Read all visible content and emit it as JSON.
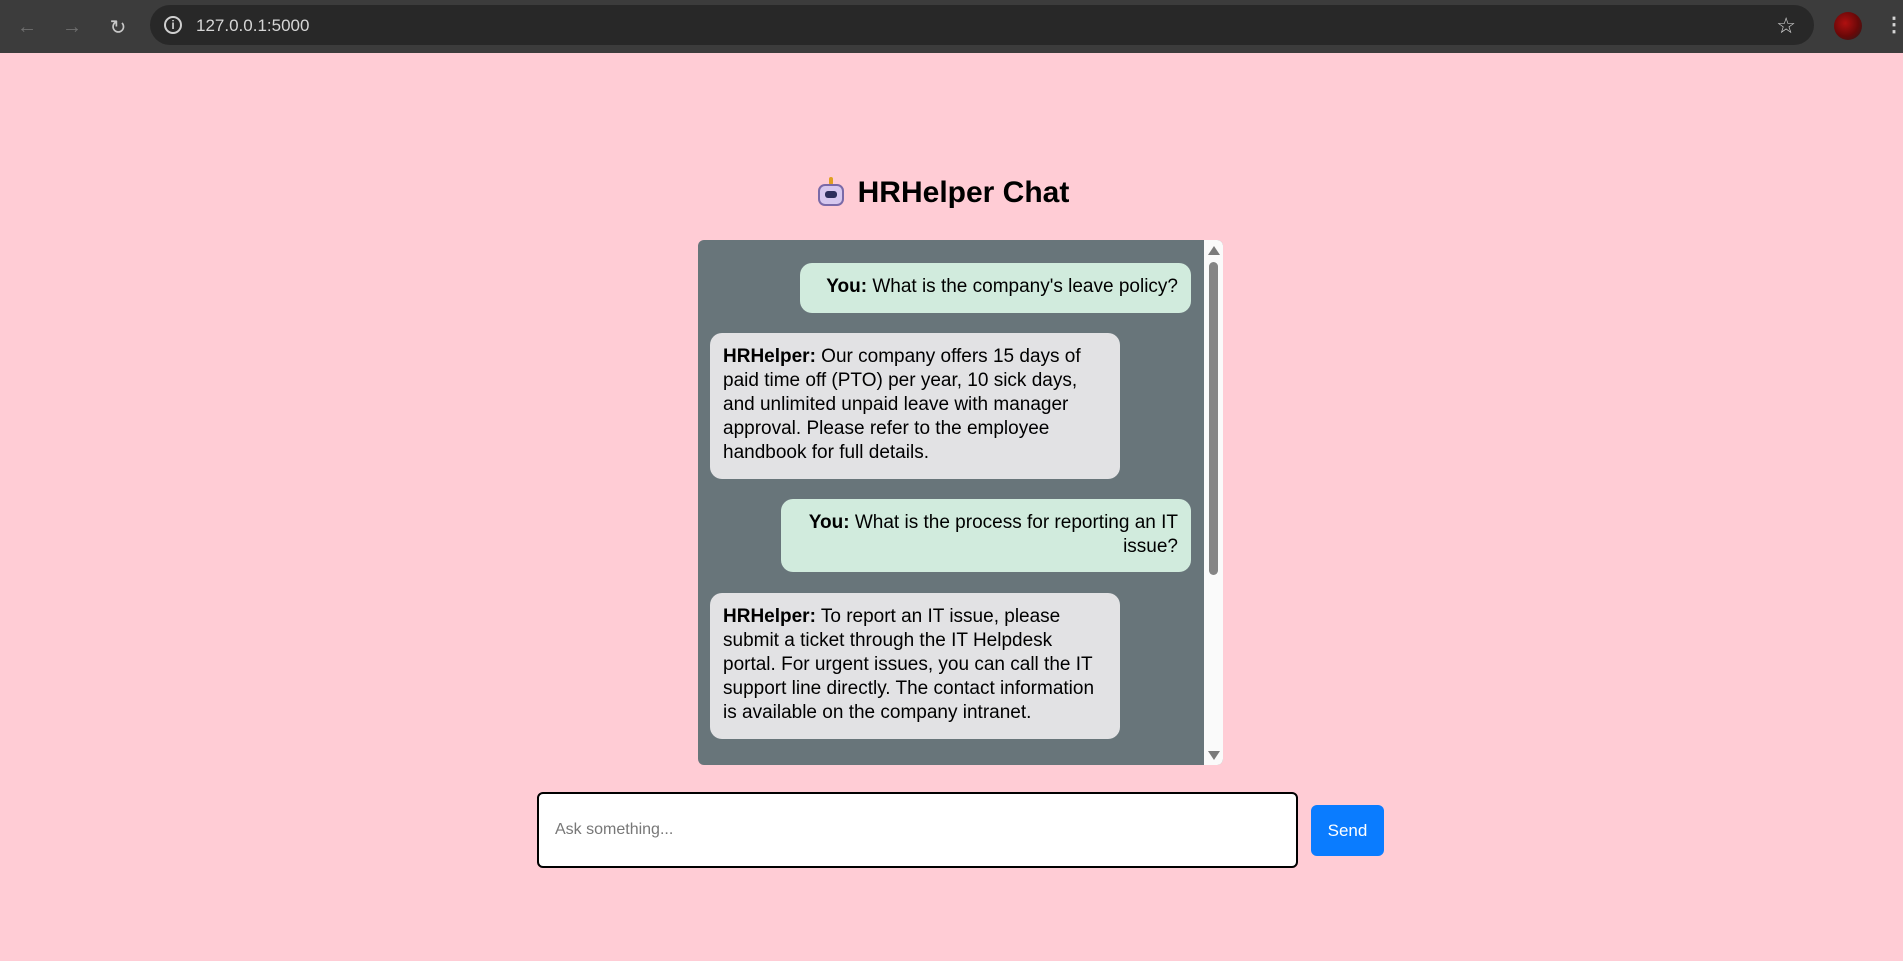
{
  "browser": {
    "url": "127.0.0.1:5000",
    "back_icon": "arrow-left-icon",
    "forward_icon": "arrow-right-icon",
    "reload_icon": "reload-icon",
    "site_info_icon": "info-icon",
    "bookmark_icon": "star-icon",
    "menu_icon": "kebab-menu-icon"
  },
  "page": {
    "title": "HRHelper Chat",
    "title_icon": "robot-icon",
    "background_color": "#ffccd5"
  },
  "chat": {
    "messages": [
      {
        "sender": "You:",
        "text": " What is the company's leave policy?",
        "role": "user"
      },
      {
        "sender": "HRHelper:",
        "text": " Our company offers 15 days of paid time off (PTO) per year, 10 sick days, and unlimited unpaid leave with manager approval. Please refer to the employee handbook for full details.",
        "role": "bot"
      },
      {
        "sender": "You:",
        "text": " What is the process for reporting an IT issue?",
        "role": "user"
      },
      {
        "sender": "HRHelper:",
        "text": " To report an IT issue, please submit a ticket through the IT Helpdesk portal. For urgent issues, you can call the IT support line directly. The contact information is available on the company intranet.",
        "role": "bot"
      }
    ],
    "user_bubble_color": "#d1ebdd",
    "bot_bubble_color": "#e2e2e4",
    "box_color": "#68757a"
  },
  "input": {
    "placeholder": "Ask something...",
    "value": ""
  },
  "send": {
    "label": "Send",
    "color": "#0a7cff"
  }
}
